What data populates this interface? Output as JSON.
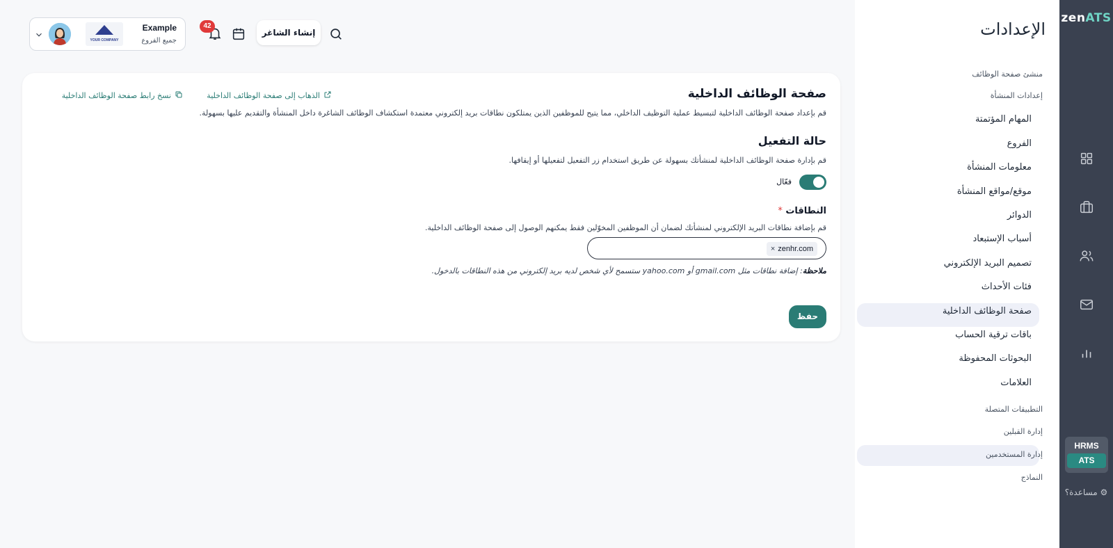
{
  "rail": {
    "logo_zen": "zen",
    "logo_ats": "ATS",
    "nav_icons": [
      "grid-icon",
      "briefcase-icon",
      "users-icon",
      "mail-icon",
      "bar-chart-icon"
    ],
    "switch_hrms": "HRMS",
    "switch_ats": "ATS",
    "help": "⚙ مساعدة؟"
  },
  "settings": {
    "title": "الإعدادات",
    "items": [
      "منشئ صفحة الوظائف",
      "إعدادات المنشأة",
      "المهام المؤتمتة",
      "الفروع",
      "معلومات المنشأة",
      "موقع/مواقع المنشأة",
      "الدوائر",
      "أسباب الإستبعاد",
      "تصميم البريد الإلكتروني",
      "فئات الأحداث",
      "صفحة الوظائف الداخلية",
      "باقات ترقية الحساب",
      "البحوثات المحفوظة",
      "العلامات",
      "التطبيقات المتصلة",
      "إدارة القبلين",
      "إدارة المستخدمين",
      "النماذج"
    ]
  },
  "topbar": {
    "create_job": "إنشاء الشاغر",
    "notifications_count": "42",
    "company_name": "Example",
    "company_branch": "جميع الفروع",
    "company_logo_text": "YOUR COMPANY"
  },
  "page": {
    "title": "صفحة الوظائف الداخلية",
    "description": "قم بإعداد صفحة الوظائف الداخلية لتبسيط عملية التوظيف الداخلي، مما يتيح للموظفين الذين يمتلكون نطاقات بريد إلكتروني معتمدة استكشاف الوظائف الشاغرة داخل المنشأة والتقديم عليها بسهولة.",
    "go_link": "الذهاب إلى صفحة الوظائف الداخلية",
    "copy_link": "نسخ رابط صفحة الوظائف الداخلية",
    "activation_title": "حالة التفعيل",
    "activation_desc": "قم بإدارة صفحة الوظائف الداخلية لمنشأتك بسهولة عن طريق استخدام زر التفعيل لتفعيلها أو إيقافها.",
    "toggle_label": "فعّال",
    "toggle_on": true,
    "domains_title": "النطاقات",
    "domains_required": "*",
    "domains_desc": "قم بإضافة نطاقات البريد الإلكتروني لمنشأتك لضمان أن الموظفين المخوّلين فقط يمكنهم الوصول إلى صفحة الوظائف الداخلية.",
    "domain_tags": [
      "zenhr.com"
    ],
    "note_label": "ملاحظة",
    "note_text": "إضافة نطاقات مثل gmail.com أو yahoo.com ستسمح لأي شخص لديه بريد إلكتروني من هذه النطاقات بالدخول.",
    "save": "حفظ"
  },
  "colors": {
    "accent": "#2a7c75",
    "rail": "#3a4150",
    "badge": "#e03a3a"
  }
}
